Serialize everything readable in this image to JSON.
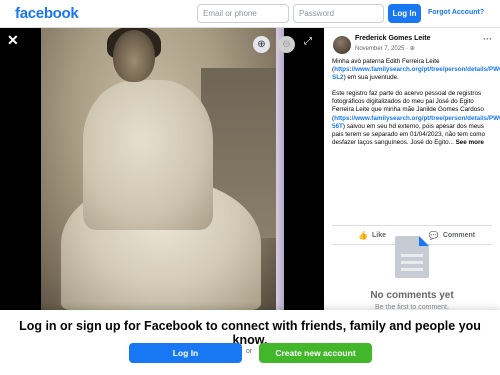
{
  "header": {
    "logo_text": "facebook",
    "email_placeholder": "Email or phone",
    "password_placeholder": "Password",
    "login_label": "Log In",
    "forgot_label": "Forgot Account?"
  },
  "viewer": {
    "close_icon": "close-icon",
    "zoom_in_icon": "zoom-in-icon",
    "zoom_out_icon": "zoom-out-icon",
    "fullscreen_icon": "fullscreen-icon"
  },
  "post": {
    "author": "Frederick Gomes Leite",
    "date": "November 7, 2025 · ",
    "para1_a": "Minha avó paterna Edith Ferreira Leite (",
    "para1_link": "https://www.familysearch.org/pt/tree/person/details/PWQN-SL2",
    "para1_b": ") em sua juventude.",
    "para2_a": "Este registro faz parte do acervo pessoal de registros fotográficos digitalizados do meu pai José do Egito Ferreira Leite que minha mãe Janilde Gomes Cardoso (",
    "para2_link": "https://www.familysearch.org/pt/tree/person/details/PWQN-56T",
    "para2_b": ") salvou em seu hd externo, pois apesar dos meus pais terem se separado em 01/04/2023, não tem como desfazer laços sanguíneos. José do Egito...",
    "see_more": "See more",
    "like_label": "Like",
    "comment_label": "Comment",
    "no_comments": "No comments yet",
    "be_first": "Be the first to comment."
  },
  "footer": {
    "prompt": "Log in or sign up for Facebook to connect with friends, family and people you know.",
    "login_label": "Log In",
    "or_label": "or",
    "create_label": "Create new account"
  },
  "colors": {
    "brand": "#1877f2",
    "create": "#42b72a"
  }
}
